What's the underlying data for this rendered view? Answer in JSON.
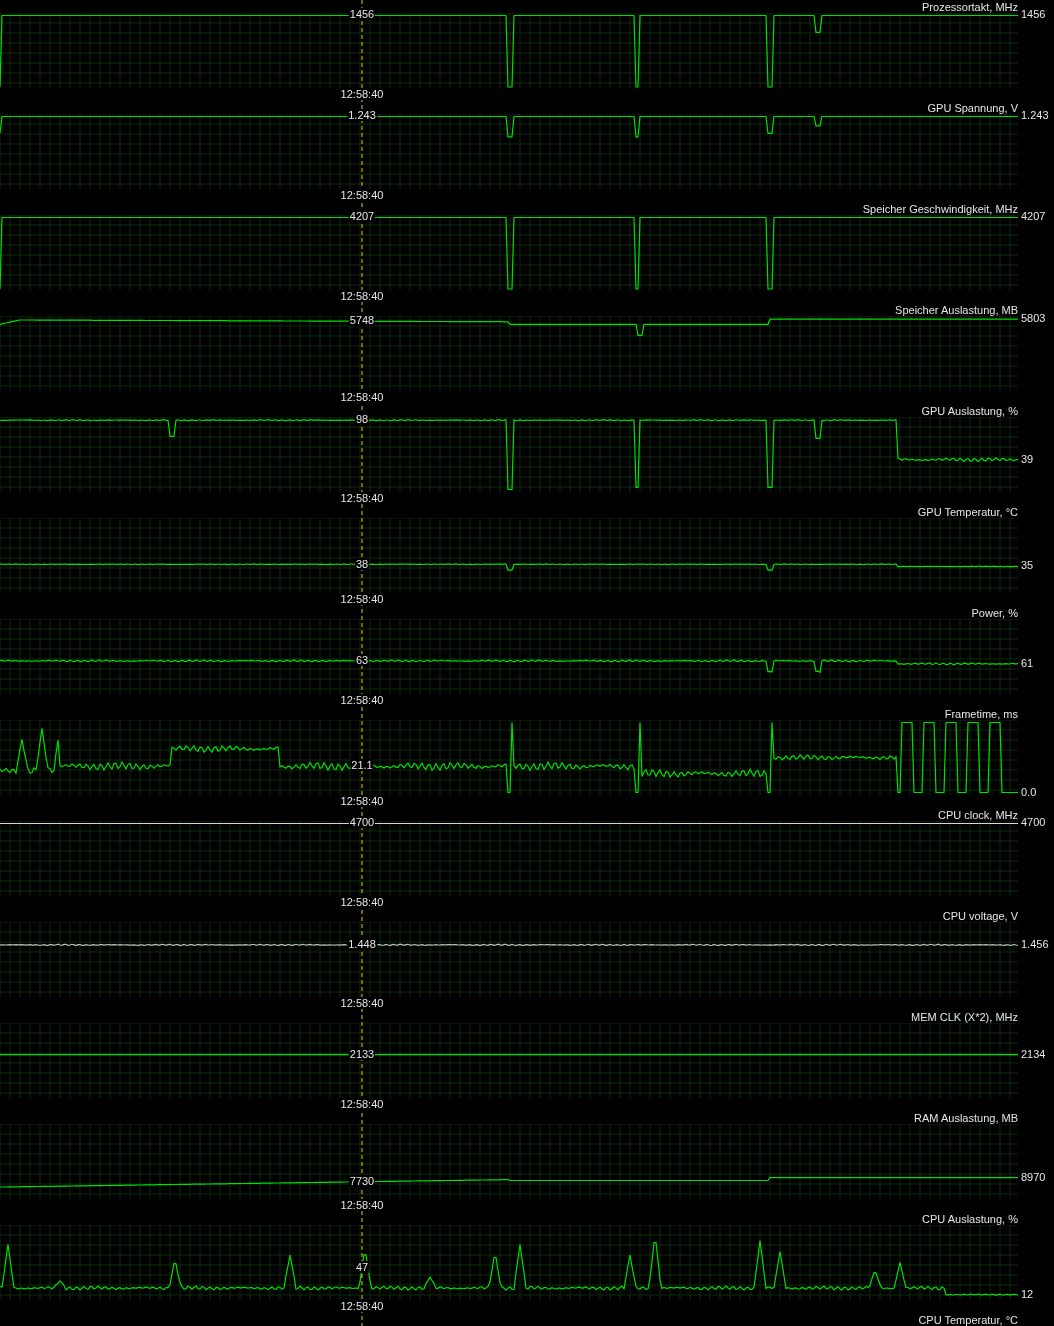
{
  "panels": [
    {
      "title": "Prozessortakt, MHz",
      "cursor_value": "1456",
      "current_value": "1456",
      "time": "12:58:40"
    },
    {
      "title": "GPU Spannung, V",
      "cursor_value": "1.243",
      "current_value": "1.243",
      "time": "12:58:40"
    },
    {
      "title": "Speicher Geschwindigkeit, MHz",
      "cursor_value": "4207",
      "current_value": "4207",
      "time": "12:58:40"
    },
    {
      "title": "Speicher Auslastung, MB",
      "cursor_value": "5748",
      "current_value": "5803",
      "time": "12:58:40"
    },
    {
      "title": "GPU Auslastung, %",
      "cursor_value": "98",
      "current_value": "39",
      "time": "12:58:40"
    },
    {
      "title": "GPU Temperatur, °C",
      "cursor_value": "38",
      "current_value": "35",
      "time": "12:58:40"
    },
    {
      "title": "Power, %",
      "cursor_value": "63",
      "current_value": "61",
      "time": "12:58:40"
    },
    {
      "title": "Frametime, ms",
      "cursor_value": "21.1",
      "current_value": "0.0",
      "time": "12:58:40"
    },
    {
      "title": "CPU clock, MHz",
      "cursor_value": "4700",
      "current_value": "4700",
      "time": "12:58:40"
    },
    {
      "title": "CPU voltage, V",
      "cursor_value": "1.448",
      "current_value": "1.456",
      "time": "12:58:40"
    },
    {
      "title": "MEM CLK (X*2), MHz",
      "cursor_value": "2133",
      "current_value": "2134",
      "time": "12:58:40"
    },
    {
      "title": "RAM Auslastung, MB",
      "cursor_value": "7730",
      "current_value": "8970",
      "time": "12:58:40"
    },
    {
      "title": "CPU Auslastung, %",
      "cursor_value": "47",
      "current_value": "12",
      "time": "12:58:40"
    }
  ],
  "next_title": "CPU Temperatur, °C"
}
